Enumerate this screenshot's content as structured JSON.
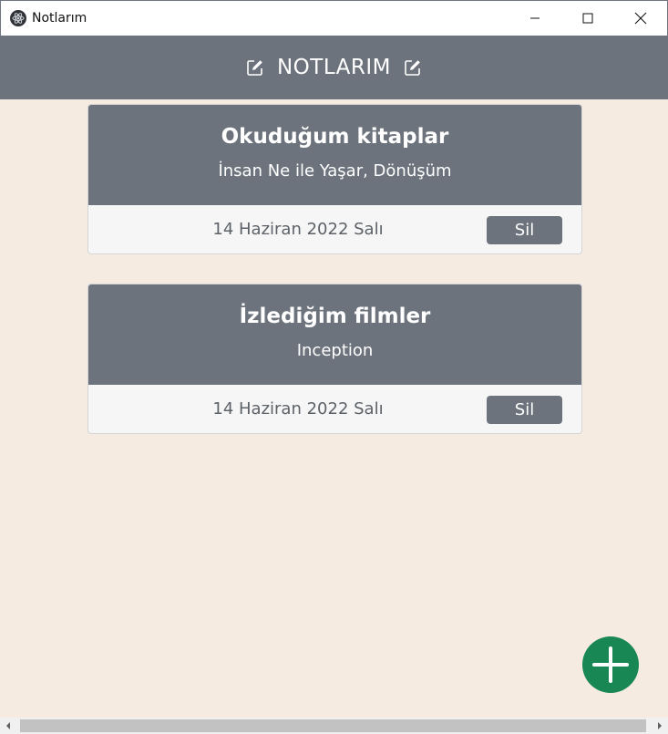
{
  "window": {
    "title": "Notlarım",
    "app_icon": "electron-icon"
  },
  "header": {
    "title": "NOTLARIM",
    "left_icon": "edit-icon",
    "right_icon": "edit-icon"
  },
  "notes": [
    {
      "title": "Okuduğum kitaplar",
      "content": "İnsan Ne ile Yaşar, Dönüşüm",
      "date": "14 Haziran 2022 Salı",
      "delete_label": "Sil"
    },
    {
      "title": "İzlediğim filmler",
      "content": "Inception",
      "date": "14 Haziran 2022 Salı",
      "delete_label": "Sil"
    }
  ],
  "fab": {
    "icon": "plus-icon",
    "color": "#198754"
  },
  "colors": {
    "header": "#6c737c",
    "background": "#f5ebe1",
    "card_footer": "#f6f6f6",
    "accent": "#198754"
  }
}
